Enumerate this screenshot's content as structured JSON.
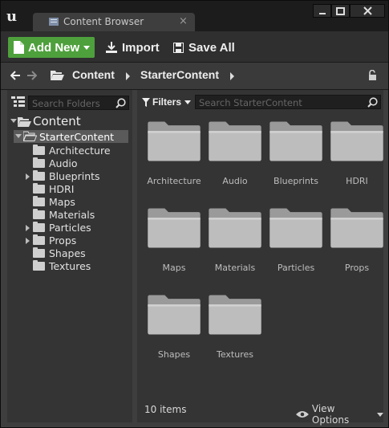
{
  "window": {
    "tab_title": "Content Browser",
    "tab_close_glyph": "×",
    "accent_add": "#4ea03c"
  },
  "toolbar": {
    "add_new_label": "Add New",
    "import_label": "Import",
    "save_all_label": "Save All"
  },
  "path": {
    "crumbs": [
      "Content",
      "StarterContent"
    ]
  },
  "left_panel": {
    "search_placeholder": "Search Folders",
    "root": "Content",
    "selected": "StarterContent",
    "children": [
      {
        "label": "Architecture",
        "expandable": false
      },
      {
        "label": "Audio",
        "expandable": false
      },
      {
        "label": "Blueprints",
        "expandable": true
      },
      {
        "label": "HDRI",
        "expandable": false
      },
      {
        "label": "Maps",
        "expandable": false
      },
      {
        "label": "Materials",
        "expandable": false
      },
      {
        "label": "Particles",
        "expandable": true
      },
      {
        "label": "Props",
        "expandable": true
      },
      {
        "label": "Shapes",
        "expandable": false
      },
      {
        "label": "Textures",
        "expandable": false
      }
    ]
  },
  "right_panel": {
    "filters_label": "Filters",
    "search_placeholder": "Search StarterContent",
    "folders": [
      "Architecture",
      "Audio",
      "Blueprints",
      "HDRI",
      "Maps",
      "Materials",
      "Particles",
      "Props",
      "Shapes",
      "Textures"
    ],
    "item_count": "10 items",
    "view_options_label": "View Options"
  }
}
